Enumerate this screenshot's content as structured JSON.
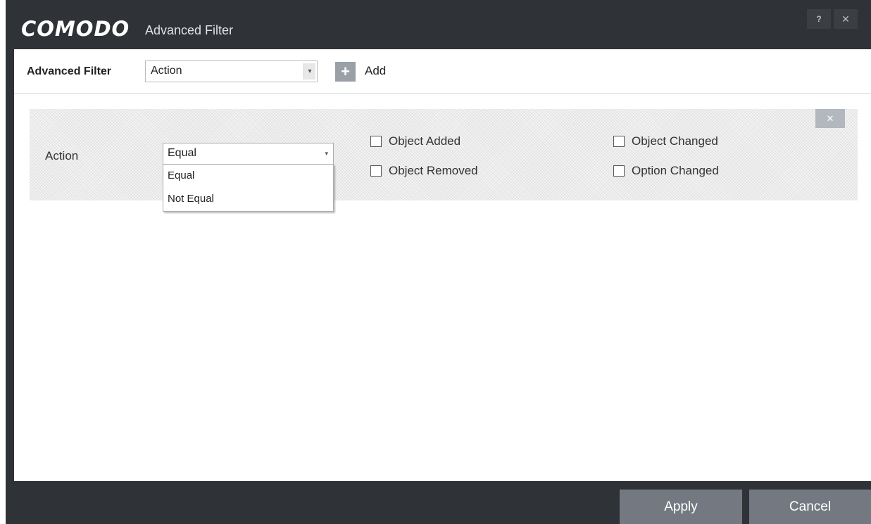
{
  "window": {
    "brand": "COMODO",
    "title": "Advanced Filter",
    "help_label": "?",
    "close_label": "✕"
  },
  "toolbar": {
    "label": "Advanced Filter",
    "select_value": "Action",
    "select_arrow": "▾",
    "add_icon": "+",
    "add_label": "Add"
  },
  "filter_row": {
    "close_label": "✕",
    "label": "Action",
    "operator_value": "Equal",
    "operator_arrow": "▾",
    "operator_options": [
      "Equal",
      "Not Equal"
    ],
    "checkboxes": [
      {
        "label": "Object Added",
        "checked": false
      },
      {
        "label": "Object Removed",
        "checked": false
      },
      {
        "label": "Object Changed",
        "checked": false
      },
      {
        "label": "Option Changed",
        "checked": false
      }
    ]
  },
  "footer": {
    "apply_label": "Apply",
    "cancel_label": "Cancel"
  },
  "colors": {
    "chrome": "#2f3236",
    "button": "#747981",
    "accent_gray": "#9aa0a7"
  }
}
